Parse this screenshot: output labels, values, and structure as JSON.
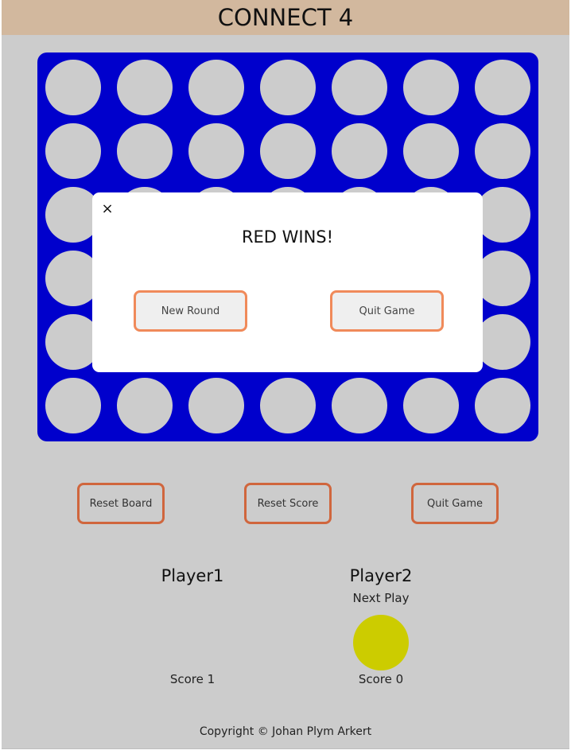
{
  "header": {
    "title": "CONNECT 4"
  },
  "board": {
    "rows": 6,
    "cols": 7,
    "board_color": "#0000cc",
    "empty_color": "#cccccc"
  },
  "modal": {
    "close_label": "×",
    "message": "RED WINS!",
    "new_round_label": "New Round",
    "quit_label": "Quit Game"
  },
  "controls": {
    "reset_board_label": "Reset Board",
    "reset_score_label": "Reset Score",
    "quit_label": "Quit Game"
  },
  "players": [
    {
      "name": "Player1",
      "score_text": "Score 1"
    },
    {
      "name": "Player2",
      "score_text": "Score 0",
      "status": "Next Play",
      "disc_color": "#cccc00"
    }
  ],
  "footer": {
    "text": "Copyright © Johan Plym Arkert"
  }
}
